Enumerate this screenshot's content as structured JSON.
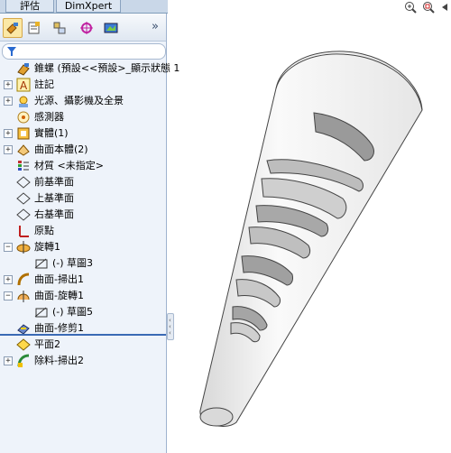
{
  "tabs": [
    {
      "label": "評估"
    },
    {
      "label": "DimXpert"
    }
  ],
  "panel": {
    "more_label": "»",
    "tree": [
      {
        "label": "錐螺  (預設<<預設>_顯示狀態 1",
        "icon": "part-icon",
        "expander": ""
      },
      {
        "label": "註記",
        "icon": "annotation-icon",
        "expander": "+"
      },
      {
        "label": "光源、攝影機及全景",
        "icon": "lights-icon",
        "expander": "+"
      },
      {
        "label": "感測器",
        "icon": "sensor-icon",
        "expander": ""
      },
      {
        "label": "實體(1)",
        "icon": "solid-bodies-icon",
        "expander": "+"
      },
      {
        "label": "曲面本體(2)",
        "icon": "surface-bodies-icon",
        "expander": "+"
      },
      {
        "label": "材質 <未指定>",
        "icon": "material-icon",
        "expander": ""
      },
      {
        "label": "前基準面",
        "icon": "plane-icon",
        "expander": ""
      },
      {
        "label": "上基準面",
        "icon": "plane-icon",
        "expander": ""
      },
      {
        "label": "右基準面",
        "icon": "plane-icon",
        "expander": ""
      },
      {
        "label": "原點",
        "icon": "origin-icon",
        "expander": ""
      },
      {
        "label": "旋轉1",
        "icon": "revolve-icon",
        "expander": "−"
      },
      {
        "label": "(-) 草圖3",
        "icon": "sketch-icon",
        "expander": ""
      },
      {
        "label": "曲面-掃出1",
        "icon": "surface-sweep-icon",
        "expander": "+"
      },
      {
        "label": "曲面-旋轉1",
        "icon": "surface-revolve-icon",
        "expander": "−"
      },
      {
        "label": "(-) 草圖5",
        "icon": "sketch-icon",
        "expander": ""
      },
      {
        "label": "曲面-修剪1",
        "icon": "surface-trim-icon",
        "expander": ""
      },
      {
        "label": "平面2",
        "icon": "plane2-icon",
        "expander": ""
      },
      {
        "label": "除料-掃出2",
        "icon": "cut-sweep-icon",
        "expander": "+"
      }
    ]
  },
  "colors": {
    "panel_bg": "#eef3fa",
    "selection": "#fbe8a6",
    "tree_end": "#3a6ab4",
    "model_face": "#f2f2f2",
    "model_shadow": "#b8b8b8"
  }
}
